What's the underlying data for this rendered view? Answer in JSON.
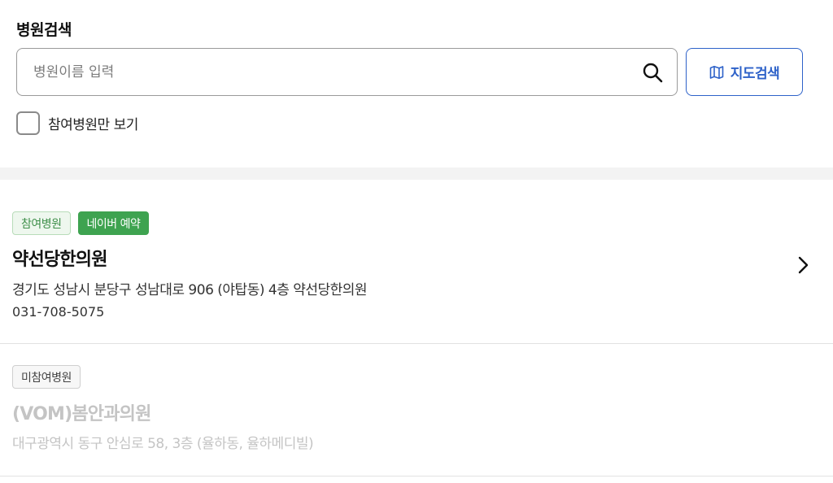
{
  "search": {
    "title": "병원검색",
    "placeholder": "병원이름 입력",
    "value": "",
    "map_button_label": "지도검색",
    "filter_label": "참여병원만 보기",
    "filter_checked": false
  },
  "colors": {
    "accent_blue": "#2e62c9",
    "participating_green": "#3f8f4a",
    "naver_green": "#3ea350",
    "disabled_gray": "#c4c4c4"
  },
  "hospitals": [
    {
      "badges": [
        "참여병원",
        "네이버 예약"
      ],
      "name": "약선당한의원",
      "address": "경기도 성남시 분당구 성남대로 906 (야탑동) 4층 약선당한의원",
      "phone": "031-708-5075",
      "icon": "chevron-right-icon"
    },
    {
      "badges": [
        "미참여병원"
      ],
      "name": "(VOM)봄안과의원",
      "address": "대구광역시 동구 안심로 58, 3층 (율하동, 율하메디빌)"
    }
  ]
}
